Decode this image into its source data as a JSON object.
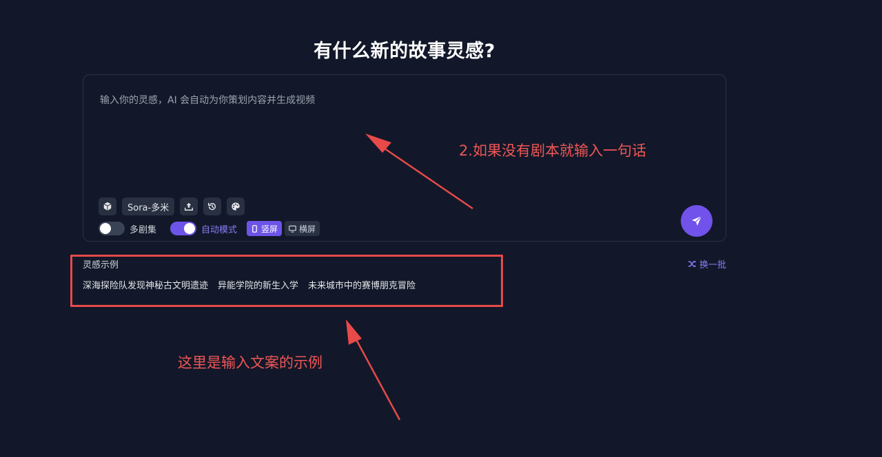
{
  "header": {
    "title": "有什么新的故事灵感?"
  },
  "composer": {
    "placeholder": "输入你的灵感，AI 会自动为你策划内容并生成视频",
    "model_label": "Sora-多米",
    "multi_episode_label": "多剧集",
    "multi_episode_on": false,
    "auto_mode_label": "自动模式",
    "auto_mode_on": true,
    "orientation": {
      "portrait_label": "竖屏",
      "landscape_label": "横屏",
      "selected": "portrait"
    },
    "tool_icons": [
      "cube-icon",
      "upload-icon",
      "history-icon",
      "palette-icon"
    ]
  },
  "inspiration": {
    "title": "灵感示例",
    "shuffle_label": "换一批",
    "examples": [
      "深海探险队发现神秘古文明遗迹",
      "异能学院的新生入学",
      "未来城市中的赛博朋克冒险"
    ]
  },
  "annotations": {
    "note_input": "2.如果没有剧本就输入一句话",
    "note_examples": "这里是输入文案的示例"
  },
  "colors": {
    "background": "#121829",
    "accent": "#7152ea",
    "annotation": "#e84a4a"
  }
}
